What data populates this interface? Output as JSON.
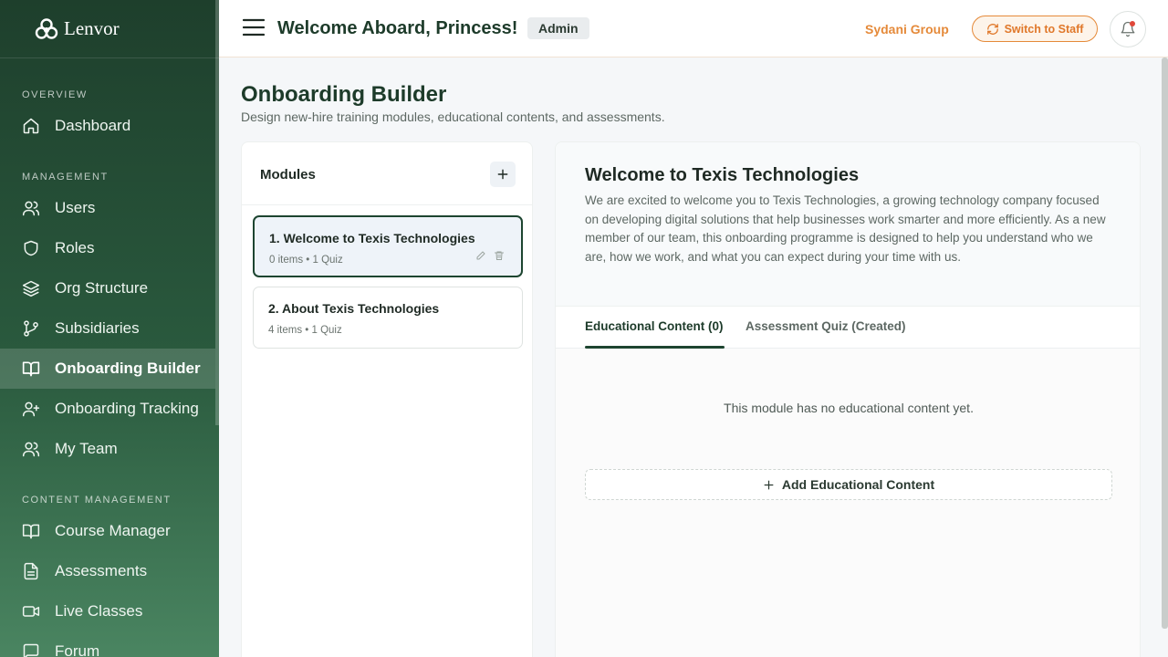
{
  "brand": {
    "name": "Lenvor"
  },
  "sidebar": {
    "sections": {
      "overview": "OVERVIEW",
      "management": "MANAGEMENT",
      "content": "CONTENT MANAGEMENT"
    },
    "items": {
      "dashboard": "Dashboard",
      "users": "Users",
      "roles": "Roles",
      "org_structure": "Org Structure",
      "subsidiaries": "Subsidiaries",
      "onboarding_builder": "Onboarding Builder",
      "onboarding_tracking": "Onboarding Tracking",
      "my_team": "My Team",
      "course_manager": "Course Manager",
      "assessments": "Assessments",
      "live_classes": "Live Classes",
      "forum": "Forum"
    },
    "active": "onboarding_builder"
  },
  "header": {
    "welcome": "Welcome Aboard, Princess!",
    "role_badge": "Admin",
    "org_name": "Sydani Group",
    "switch_label": "Switch to Staff"
  },
  "page": {
    "title": "Onboarding Builder",
    "subtitle": "Design new-hire training modules, educational contents, and assessments."
  },
  "modules": {
    "title": "Modules",
    "items": [
      {
        "title": "1. Welcome to Texis Technologies",
        "meta": "0 items • 1 Quiz"
      },
      {
        "title": "2. About Texis Technologies",
        "meta": "4 items • 1 Quiz"
      }
    ]
  },
  "detail": {
    "title": "Welcome to Texis Technologies",
    "description": "We are excited to welcome you to Texis Technologies, a growing technology company focused on developing digital solutions that help businesses work smarter and more efficiently. As a new member of our team, this onboarding programme is designed to help you understand who we are, how we work, and what you can expect during your time with us.",
    "tabs": [
      "Educational Content (0)",
      "Assessment Quiz (Created)"
    ],
    "empty_text": "This module has no educational content yet.",
    "add_label": "Add Educational Content"
  },
  "colors": {
    "sidebar_dark": "#1e3f2c",
    "sidebar_light": "#4a8561",
    "accent_orange": "#e58a3a",
    "primary_green": "#1d4530"
  }
}
